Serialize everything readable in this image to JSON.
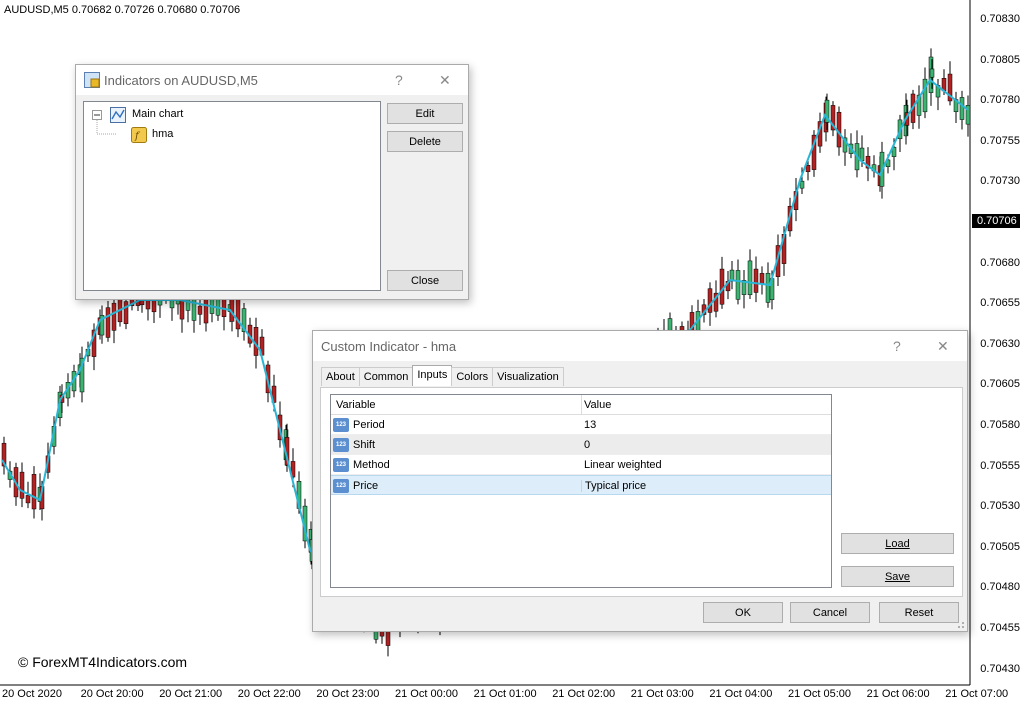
{
  "chart": {
    "symbol_info": "AUDUSD,M5  0.70682 0.70726 0.70680 0.70706",
    "price_labels": [
      "0.70830",
      "0.70805",
      "0.70780",
      "0.70755",
      "0.70730",
      "0.70706",
      "0.70680",
      "0.70655",
      "0.70630",
      "0.70605",
      "0.70580",
      "0.70555",
      "0.70530",
      "0.70505",
      "0.70480",
      "0.70455",
      "0.70430"
    ],
    "current_price": "0.70706",
    "time_labels": [
      "20 Oct 2020",
      "20 Oct 20:00",
      "20 Oct 21:00",
      "20 Oct 22:00",
      "20 Oct 23:00",
      "21 Oct 00:00",
      "21 Oct 01:00",
      "21 Oct 02:00",
      "21 Oct 03:00",
      "21 Oct 04:00",
      "21 Oct 05:00",
      "21 Oct 06:00",
      "21 Oct 07:00"
    ],
    "watermark": "© ForexMT4Indicators.com",
    "colors": {
      "bull": "#3cb371",
      "bear": "#b22222",
      "hma": "#29b6d6"
    }
  },
  "indicators_dialog": {
    "title": "Indicators on AUDUSD,M5",
    "help": "?",
    "close_x": "✕",
    "tree": {
      "root": "Main chart",
      "child": "hma"
    },
    "buttons": {
      "edit": "Edit",
      "delete": "Delete",
      "close": "Close"
    }
  },
  "custom_dialog": {
    "title": "Custom Indicator - hma",
    "help": "?",
    "close_x": "✕",
    "tabs": [
      "About",
      "Common",
      "Inputs",
      "Colors",
      "Visualization"
    ],
    "active_tab": "Inputs",
    "columns": {
      "variable": "Variable",
      "value": "Value"
    },
    "rows": [
      {
        "variable": "Period",
        "value": "13"
      },
      {
        "variable": "Shift",
        "value": "0"
      },
      {
        "variable": "Method",
        "value": "Linear weighted"
      },
      {
        "variable": "Price",
        "value": "Typical price"
      }
    ],
    "row_icon": "123",
    "buttons": {
      "load": "Load",
      "save": "Save",
      "ok": "OK",
      "cancel": "Cancel",
      "reset": "Reset"
    }
  }
}
